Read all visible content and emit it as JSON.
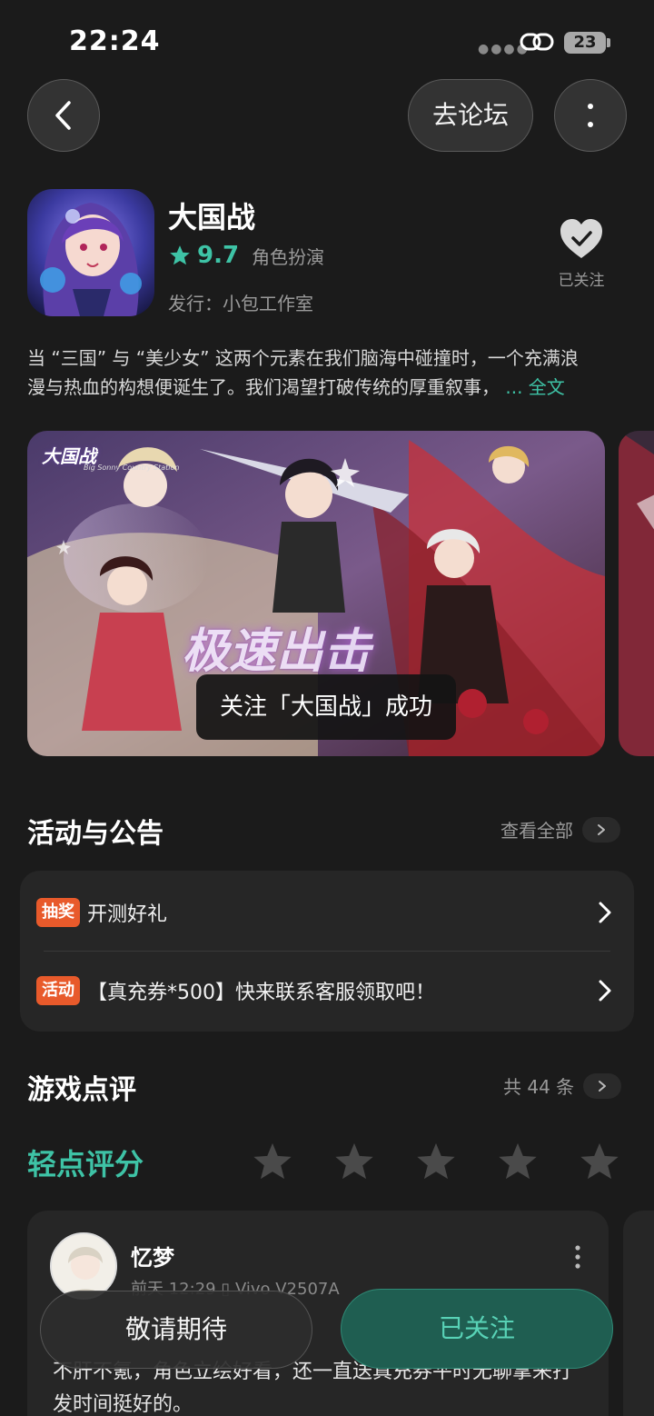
{
  "status_bar": {
    "time": "22:24",
    "battery": "23"
  },
  "header": {
    "forum_label": "去论坛"
  },
  "app": {
    "title": "大国战",
    "rating": "9.7",
    "genre": "角色扮演",
    "publisher": "发行：小包工作室",
    "follow_label": "已关注",
    "description_line1": "当 “三国” 与 “美少女” 这两个元素在我们脑海中碰撞时，一个充满浪",
    "description_line2": "漫与热血的构想便诞生了。我们渴望打破传统的厚重叙事，",
    "description_more": "... 全文"
  },
  "gallery": {
    "logo_text": "大国战",
    "logo_sub": "Big Sonny Country Station",
    "headline": "极速出击"
  },
  "toast": {
    "text": "关注「大国战」成功"
  },
  "events": {
    "title": "活动与公告",
    "view_all": "查看全部",
    "items": [
      {
        "badge": "抽奖",
        "text": "开测好礼"
      },
      {
        "badge": "活动",
        "text": "【真充券*500】快来联系客服领取吧！"
      }
    ]
  },
  "reviews": {
    "title": "游戏点评",
    "count": "共 44 条",
    "rate_label": "轻点评分",
    "items": [
      {
        "name": "忆梦",
        "meta": "前天 12:29  ▯ Vivo V2507A",
        "text": "不肝不氪，角色立绘好看，还一直送真充券平时无聊拿来打发时间挺好的。"
      }
    ]
  },
  "bottom": {
    "left_label": "敬请期待",
    "right_label": "已关注"
  },
  "colors": {
    "accent": "#3ec3a6",
    "badge": "#e85a2b",
    "background": "#1b1b1b",
    "card": "#262626"
  }
}
